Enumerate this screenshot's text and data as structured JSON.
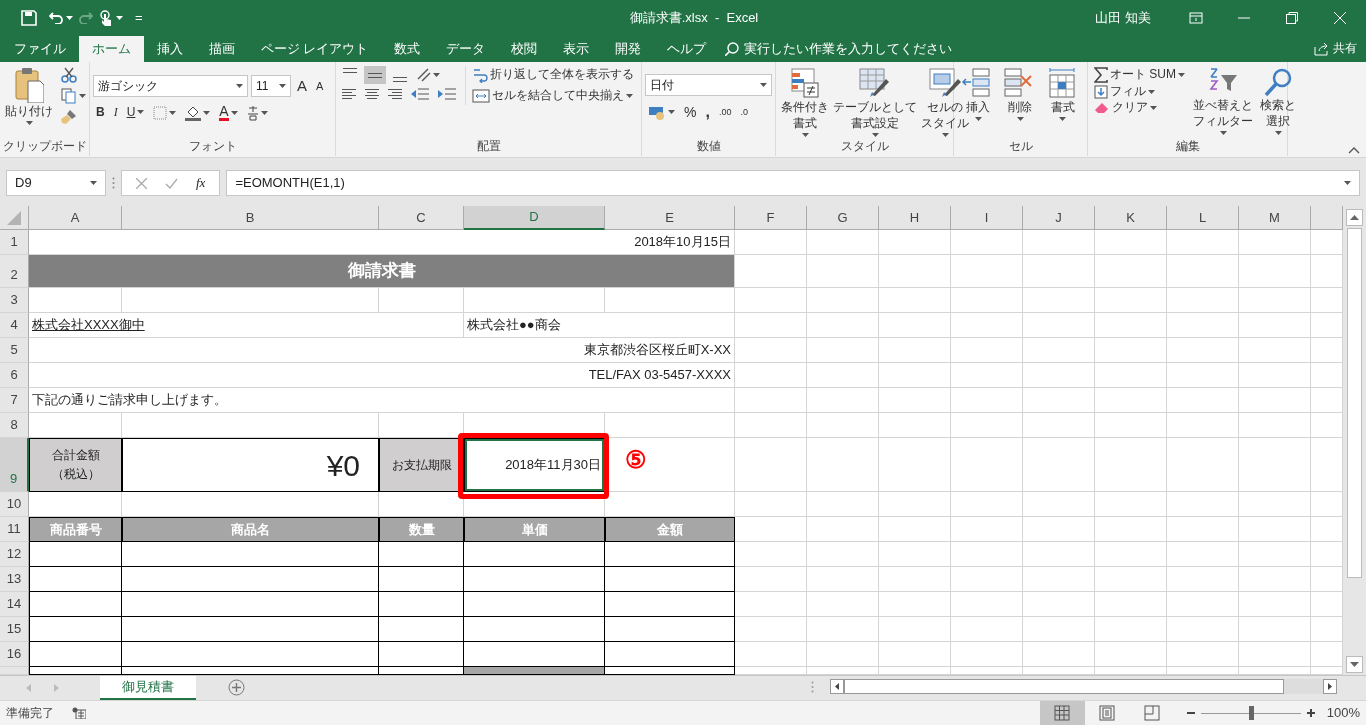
{
  "window": {
    "title": "御請求書.xlsx  -  Excel",
    "user": "山田 知美"
  },
  "quick_access": {
    "more": "="
  },
  "menu_tabs": [
    {
      "label": "ファイル",
      "selected": false
    },
    {
      "label": "ホーム",
      "selected": true
    },
    {
      "label": "挿入",
      "selected": false
    },
    {
      "label": "描画",
      "selected": false
    },
    {
      "label": "ページ レイアウト",
      "selected": false
    },
    {
      "label": "数式",
      "selected": false
    },
    {
      "label": "データ",
      "selected": false
    },
    {
      "label": "校閲",
      "selected": false
    },
    {
      "label": "表示",
      "selected": false
    },
    {
      "label": "開発",
      "selected": false
    },
    {
      "label": "ヘルプ",
      "selected": false
    }
  ],
  "tell_me": {
    "placeholder": "実行したい作業を入力してください"
  },
  "share": "共有",
  "ribbon": {
    "groups": [
      {
        "kind": "clipboard",
        "label": "クリップボード",
        "paste": "貼り付け"
      },
      {
        "kind": "font",
        "label": "フォント",
        "font": "游ゴシック",
        "size": "11",
        "grow": "A",
        "shrink": "A",
        "bold": "B",
        "italic": "I",
        "underline": "U",
        "font_color_letter": "A"
      },
      {
        "kind": "alignment",
        "label": "配置",
        "vertical_align": [
          {
            "selected": false
          },
          {
            "selected": true
          },
          {
            "selected": false
          }
        ],
        "wrap": "折り返して全体を表示する",
        "merge": "セルを結合して中央揃え"
      },
      {
        "kind": "number",
        "label": "数値",
        "format": "日付",
        "percent": "%",
        "comma": ",",
        "increase": ".00",
        "decrease": ".0"
      },
      {
        "kind": "large",
        "label": "スタイル",
        "buttons": [
          [
            "条件付き",
            "書式"
          ],
          [
            "テーブルとして",
            "書式設定"
          ],
          [
            "セルの",
            "スタイル"
          ]
        ]
      },
      {
        "kind": "large",
        "label": "セル",
        "buttons": [
          [
            "挿入"
          ],
          [
            "削除"
          ],
          [
            "書式"
          ]
        ]
      },
      {
        "kind": "editing",
        "label": "編集",
        "items": [
          "オート SUM",
          "フィル",
          "クリア"
        ],
        "buttons": [
          [
            "並べ替えと",
            "フィルター"
          ],
          [
            "検索と",
            "選択"
          ]
        ]
      }
    ]
  },
  "formula_bar": {
    "name_box": "D9",
    "fx": "fx",
    "formula": "=EOMONTH(E1,1)"
  },
  "sheet": {
    "columns": [
      {
        "label": "A",
        "selected": false
      },
      {
        "label": "B",
        "selected": false
      },
      {
        "label": "C",
        "selected": false
      },
      {
        "label": "D",
        "selected": true
      },
      {
        "label": "E",
        "selected": false
      },
      {
        "label": "F",
        "selected": false
      },
      {
        "label": "G",
        "selected": false
      },
      {
        "label": "H",
        "selected": false
      },
      {
        "label": "I",
        "selected": false
      },
      {
        "label": "J",
        "selected": false
      },
      {
        "label": "K",
        "selected": false
      },
      {
        "label": "L",
        "selected": false
      },
      {
        "label": "M",
        "selected": false
      }
    ],
    "rows": [
      {
        "label": "1",
        "selected": false,
        "kind": "plain",
        "e": {
          "text": "2018年10月15日",
          "kind": "right"
        }
      },
      {
        "label": "2",
        "selected": false,
        "kind": "title",
        "text": "御請求書"
      },
      {
        "label": "3",
        "selected": false,
        "kind": "plain"
      },
      {
        "label": "4",
        "selected": false,
        "kind": "plain",
        "a": {
          "text": "株式会社XXXX御中",
          "kind": "left",
          "underline": true
        },
        "d": {
          "text": "株式会社●●商会",
          "kind": "left"
        }
      },
      {
        "label": "5",
        "selected": false,
        "kind": "plain",
        "e": {
          "text": "東京都渋谷区桜丘町X-XX",
          "kind": "right"
        }
      },
      {
        "label": "6",
        "selected": false,
        "kind": "plain",
        "e": {
          "text": "TEL/FAX 03-5457-XXXX",
          "kind": "right"
        }
      },
      {
        "label": "7",
        "selected": false,
        "kind": "plain",
        "a": {
          "text": "下記の通りご請求申し上げます。",
          "kind": "left"
        }
      },
      {
        "label": "8",
        "selected": false,
        "kind": "plain"
      },
      {
        "label": "9",
        "selected": true,
        "kind": "form",
        "a": {
          "lines": [
            "合計金額",
            "（税込）"
          ],
          "kind": "label"
        },
        "b": {
          "text": "¥0",
          "kind": "amount"
        },
        "c": {
          "text": "お支払期限",
          "kind": "label"
        },
        "d": {
          "text": "2018年11月30日",
          "kind": "value",
          "selected": true
        }
      },
      {
        "label": "10",
        "selected": false,
        "kind": "plain"
      },
      {
        "label": "11",
        "selected": false,
        "kind": "header",
        "a": {
          "text": "商品番号"
        },
        "b": {
          "text": "商品名"
        },
        "c": {
          "text": "数量"
        },
        "d": {
          "text": "単価"
        },
        "e": {
          "text": "金額"
        }
      },
      {
        "label": "12",
        "selected": false,
        "kind": "table"
      },
      {
        "label": "13",
        "selected": false,
        "kind": "table"
      },
      {
        "label": "14",
        "selected": false,
        "kind": "table"
      },
      {
        "label": "15",
        "selected": false,
        "kind": "table"
      },
      {
        "label": "16",
        "selected": false,
        "kind": "table"
      },
      {
        "kind": "partial"
      }
    ]
  },
  "annotation": {
    "text": "⑤"
  },
  "sheet_tabs": [
    {
      "label": "御見積書",
      "selected": true
    }
  ],
  "status_bar": {
    "text": "準備完了",
    "views": [
      {
        "selected": true
      },
      {
        "selected": false
      },
      {
        "selected": false
      }
    ],
    "zoom": {
      "level": 0.5,
      "text": "100%"
    }
  }
}
